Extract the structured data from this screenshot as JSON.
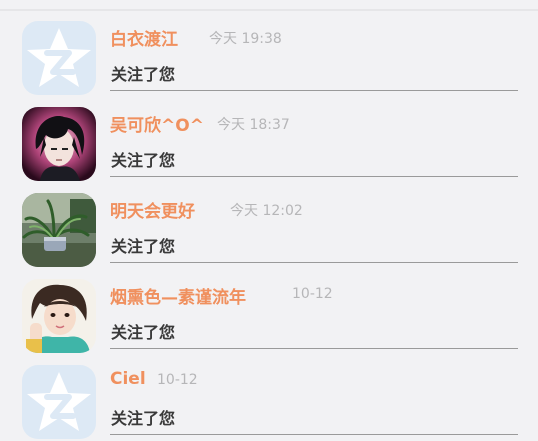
{
  "feed": {
    "items": [
      {
        "user": "白衣渡江",
        "time": "今天 19:38",
        "action": "关注了您",
        "avatar_icon": "qq-default-avatar-icon"
      },
      {
        "user": "吴可欣^O^",
        "time": "今天 18:37",
        "action": "关注了您",
        "avatar_icon": "anime-boy-avatar"
      },
      {
        "user": "明天会更好",
        "time": "今天 12:02",
        "action": "关注了您",
        "avatar_icon": "plant-photo-avatar"
      },
      {
        "user": "烟熏色—素谨流年",
        "time": "10-12",
        "action": "关注了您",
        "avatar_icon": "girl-photo-avatar"
      },
      {
        "user": "Ciel",
        "time": "10-12",
        "action": "关注了您",
        "avatar_icon": "qq-default-avatar-icon"
      }
    ]
  },
  "colors": {
    "name": "#f0905e",
    "time": "#b6b6b8",
    "action": "#3a3a3a",
    "background": "#f2f2f4",
    "default_avatar_bg": "#dde9f5"
  }
}
